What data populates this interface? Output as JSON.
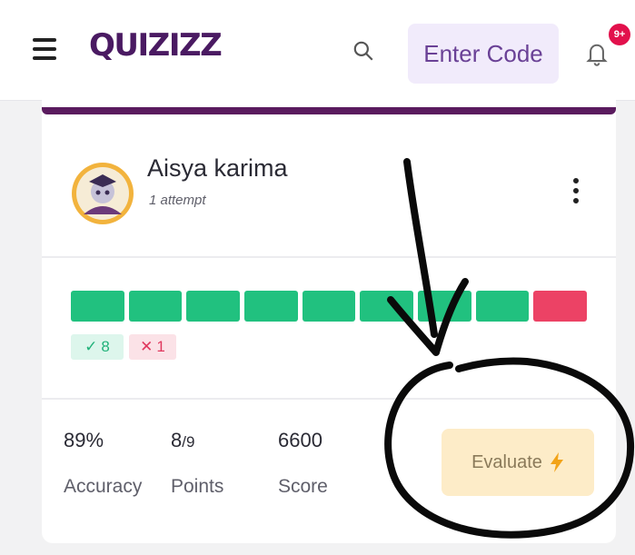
{
  "header": {
    "logo_text": "QUIZIZZ",
    "enter_code_label": "Enter Code",
    "notification_count": "9+",
    "search_icon": "search-icon",
    "bell_icon": "bell-icon"
  },
  "student": {
    "name": "Aisya karima",
    "attempts": "1 attempt"
  },
  "results": {
    "questions": [
      "correct",
      "correct",
      "correct",
      "correct",
      "correct",
      "correct",
      "correct",
      "correct",
      "incorrect"
    ],
    "correct_count": "8",
    "incorrect_count": "1"
  },
  "stats": {
    "accuracy_value": "89%",
    "accuracy_label": "Accuracy",
    "points_earned": "8",
    "points_total": "/9",
    "points_label": "Points",
    "score_value": "6600",
    "score_label": "Score"
  },
  "evaluate": {
    "label": "Evaluate",
    "icon": "lightning-icon"
  },
  "colors": {
    "brand": "#4a1a62",
    "correct": "#21c17f",
    "incorrect": "#ec4265",
    "evaluate_bg": "#fdecc8"
  }
}
